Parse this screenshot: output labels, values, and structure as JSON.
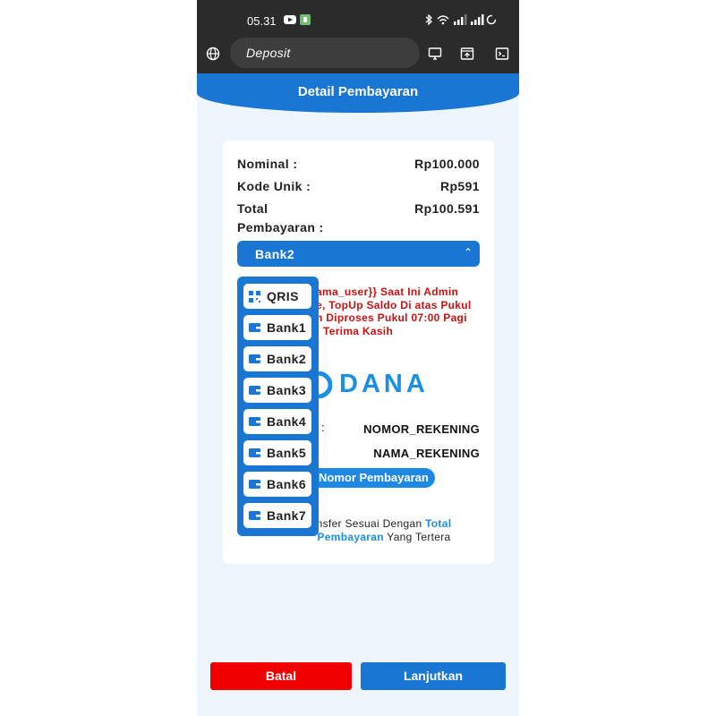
{
  "status_bar": {
    "time": "05.31"
  },
  "browser": {
    "url_title": "Deposit"
  },
  "header": {
    "title": "Detail Pembayaran"
  },
  "summary": {
    "nominal_label": "Nominal :",
    "nominal_value": "Rp100.000",
    "kode_label": "Kode Unik :",
    "kode_value": "Rp591",
    "total_label_1": "Total",
    "total_label_2": "Pembayaran :",
    "total_value": "Rp100.591"
  },
  "payment_select": {
    "selected": "Bank2"
  },
  "notice": {
    "line1": "ama_user}} Saat Ini Admin",
    "line2": "e, TopUp Saldo Di atas Pukul",
    "line3": "n Diproses Pukul 07:00 Pagi",
    "line4": "Terima Kasih"
  },
  "bank_logo_text": "DANA",
  "account": {
    "colon": ":",
    "number": "NOMOR_REKENING",
    "name": "NAMA_REKENING"
  },
  "copy_button": {
    "label": "Nomor Pembayaran"
  },
  "instruction": {
    "part1": "nsfer Sesuai Dengan ",
    "highlight1": "Total",
    "highlight2": "Pembayaran",
    "part2": " Yang Tertera"
  },
  "dropdown": {
    "items": [
      {
        "label": "QRIS",
        "icon": "qr-icon"
      },
      {
        "label": "Bank1",
        "icon": "wallet-icon"
      },
      {
        "label": "Bank2",
        "icon": "wallet-icon"
      },
      {
        "label": "Bank3",
        "icon": "wallet-icon"
      },
      {
        "label": "Bank4",
        "icon": "wallet-icon"
      },
      {
        "label": "Bank5",
        "icon": "wallet-icon"
      },
      {
        "label": "Bank6",
        "icon": "wallet-icon"
      },
      {
        "label": "Bank7",
        "icon": "wallet-icon"
      }
    ]
  },
  "footer": {
    "cancel_label": "Batal",
    "continue_label": "Lanjutkan"
  },
  "colors": {
    "primary": "#1976d2",
    "danger": "#f00000",
    "notice": "#cc1111",
    "dana": "#1a8fe3"
  }
}
